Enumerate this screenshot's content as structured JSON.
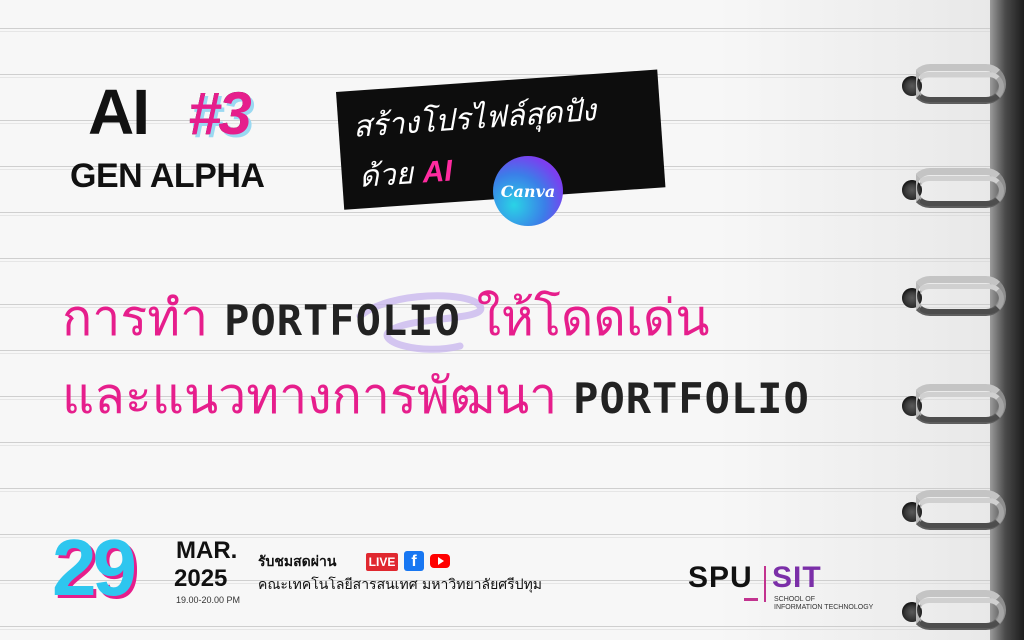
{
  "header": {
    "ai": "AI",
    "episode": "#3",
    "subtitle": "GEN ALPHA"
  },
  "tagline": {
    "line1": "สร้างโปรไฟล์สุดปัง",
    "line2_prefix": "ด้วย",
    "line2_ai": "AI",
    "canva_label": "Canva"
  },
  "headline": {
    "line1_thai_a": "การทำ",
    "line1_eng": "PORTFOLIO",
    "line1_thai_b": "ให้โดดเด่น",
    "line2_thai": "และแนวทางการพัฒนา",
    "line2_eng": "PORTFOLIO"
  },
  "event": {
    "day": "29",
    "month": "MAR.",
    "year": "2025",
    "time": "19.00-20.00 PM"
  },
  "broadcast": {
    "label": "รับชมสดผ่าน",
    "live_badge": "LIVE",
    "facebook_icon": "facebook-icon",
    "youtube_icon": "youtube-icon",
    "organizer": "คณะเทคโนโลยีสารสนเทศ มหาวิทยาลัยศรีปทุม"
  },
  "logo": {
    "spu": "SPU",
    "sit": "SIT",
    "sit_sub1": "SCHOOL OF",
    "sit_sub2": "INFORMATION TECHNOLOGY"
  },
  "colors": {
    "accent_pink": "#e61e8c",
    "accent_cyan": "#2ec6ef",
    "accent_purple": "#7b2fa8"
  }
}
